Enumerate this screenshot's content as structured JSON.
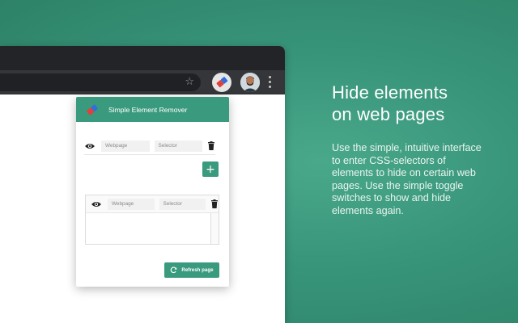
{
  "colors": {
    "accent": "#3a9a7d",
    "background": "#38957a",
    "browser_chrome_dark": "#232427",
    "browser_toolbar": "#35363a"
  },
  "browser": {
    "icons": [
      "star-icon",
      "extension-icon",
      "avatar",
      "menu-icon"
    ]
  },
  "popup": {
    "title": "Simple Element Remover",
    "rules": [
      {
        "webpage_placeholder": "Webpage",
        "selector_placeholder": "Selector"
      },
      {
        "webpage_placeholder": "Webpage",
        "selector_placeholder": "Selector"
      }
    ],
    "add_label": "+",
    "refresh_label": "Refresh page"
  },
  "promo": {
    "headline_line1": "Hide elements",
    "headline_line2": "on web pages",
    "description": "Use the simple, intuitive interface to enter CSS-selectors of elements to hide on certain web pages. Use the simple toggle switches to show and hide elements again."
  }
}
